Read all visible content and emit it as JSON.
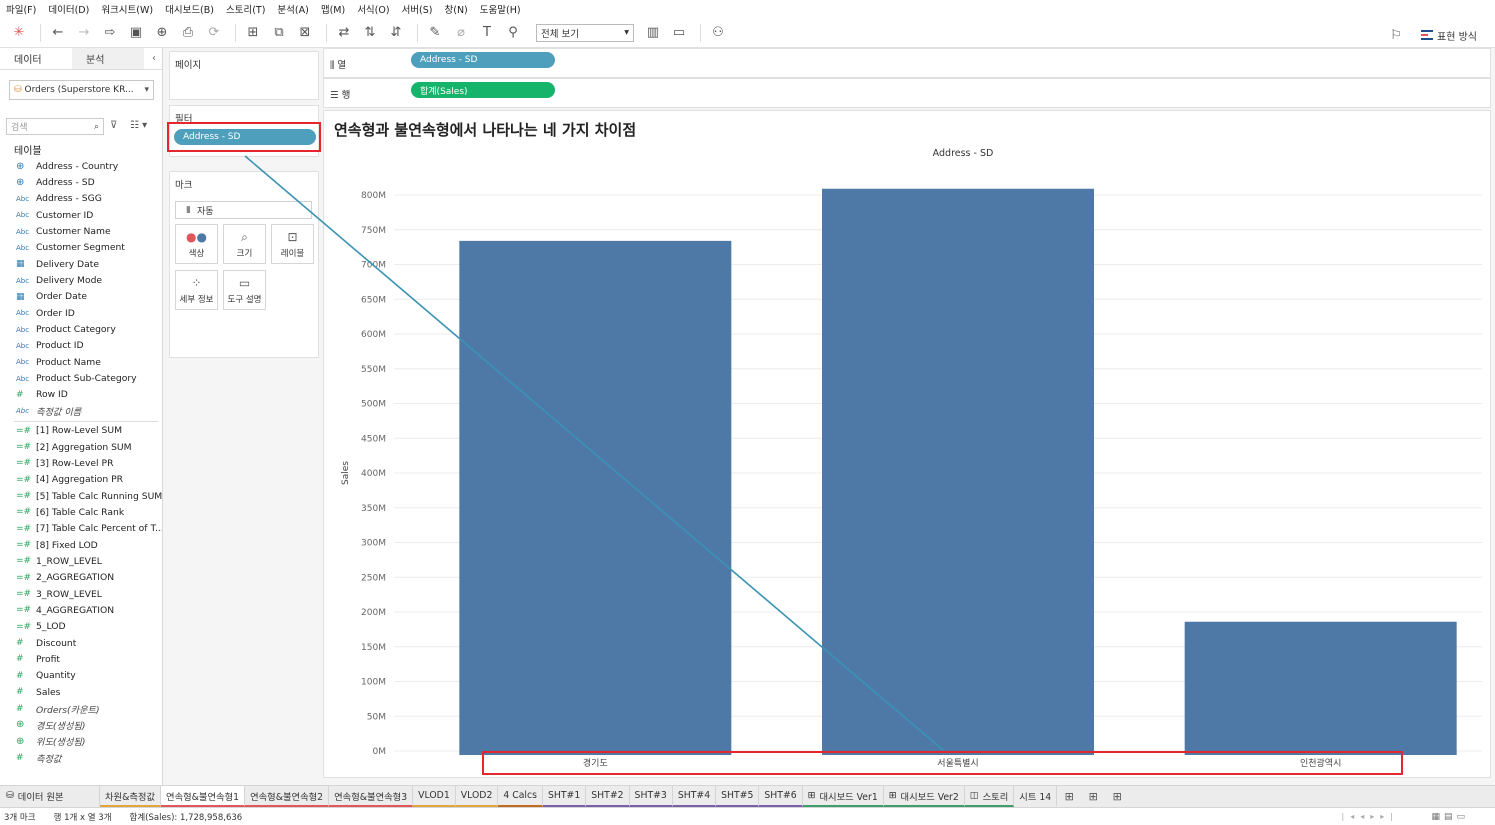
{
  "menu": [
    "파일(F)",
    "데이터(D)",
    "워크시트(W)",
    "대시보드(B)",
    "스토리(T)",
    "분석(A)",
    "맵(M)",
    "서식(O)",
    "서버(S)",
    "창(N)",
    "도움말(H)"
  ],
  "toolbar": {
    "fit_select": "전체 보기",
    "presentation_mode": "표현 방식"
  },
  "data_pane": {
    "tab_data": "데이터",
    "tab_analysis": "분석",
    "datasource": "Orders (Superstore KR...",
    "search_placeholder": "검색",
    "tables_label": "테이블",
    "fields": [
      {
        "type": "geo",
        "name": "Address - Country"
      },
      {
        "type": "geo",
        "name": "Address - SD"
      },
      {
        "type": "abc",
        "name": "Address - SGG"
      },
      {
        "type": "abc",
        "name": "Customer ID"
      },
      {
        "type": "abc",
        "name": "Customer Name"
      },
      {
        "type": "abc",
        "name": "Customer Segment"
      },
      {
        "type": "date",
        "name": "Delivery Date"
      },
      {
        "type": "abc",
        "name": "Delivery Mode"
      },
      {
        "type": "date",
        "name": "Order Date"
      },
      {
        "type": "abc",
        "name": "Order ID"
      },
      {
        "type": "abc",
        "name": "Product Category"
      },
      {
        "type": "abc",
        "name": "Product ID"
      },
      {
        "type": "abc",
        "name": "Product Name"
      },
      {
        "type": "abc",
        "name": "Product Sub-Category"
      },
      {
        "type": "num",
        "name": "Row ID"
      },
      {
        "type": "abc",
        "name": "측정값 이름",
        "italic": true
      },
      {
        "type": "sep"
      },
      {
        "type": "calc",
        "name": "[1] Row-Level SUM"
      },
      {
        "type": "calc",
        "name": "[2] Aggregation SUM"
      },
      {
        "type": "calc",
        "name": "[3] Row-Level PR"
      },
      {
        "type": "calc",
        "name": "[4] Aggregation PR"
      },
      {
        "type": "calc",
        "name": "[5] Table Calc Running SUM"
      },
      {
        "type": "calc",
        "name": "[6] Table Calc Rank"
      },
      {
        "type": "calc",
        "name": "[7] Table Calc Percent of T..."
      },
      {
        "type": "calc",
        "name": "[8] Fixed LOD"
      },
      {
        "type": "calc",
        "name": "1_ROW_LEVEL"
      },
      {
        "type": "calc",
        "name": "2_AGGREGATION"
      },
      {
        "type": "calc",
        "name": "3_ROW_LEVEL"
      },
      {
        "type": "calc",
        "name": "4_AGGREGATION"
      },
      {
        "type": "calc",
        "name": "5_LOD"
      },
      {
        "type": "num",
        "name": "Discount"
      },
      {
        "type": "num",
        "name": "Profit"
      },
      {
        "type": "num",
        "name": "Quantity"
      },
      {
        "type": "num",
        "name": "Sales"
      },
      {
        "type": "num",
        "name": "Orders(카운트)",
        "italic": true
      },
      {
        "type": "geo-green",
        "name": "경도(생성됨)",
        "italic": true
      },
      {
        "type": "geo-green",
        "name": "위도(생성됨)",
        "italic": true
      },
      {
        "type": "num",
        "name": "측정값",
        "italic": true
      }
    ]
  },
  "shelves": {
    "pages_title": "페이지",
    "filters_title": "필터",
    "filter_pill": "Address - SD",
    "marks_title": "마크",
    "marks_type": "자동",
    "mark_buttons": [
      "색상",
      "크기",
      "레이블",
      "세부 정보",
      "도구 설명"
    ],
    "columns_label": "열",
    "columns_pill": "Address - SD",
    "rows_label": "행",
    "rows_pill": "합계(Sales)"
  },
  "sheet": {
    "title": "연속형과 불연속형에서 나타나는 네 가지 차이점"
  },
  "chart_data": {
    "type": "bar",
    "title": "연속형과 불연속형에서 나타나는 네 가지 차이점",
    "column_header": "Address - SD",
    "ylabel": "Sales",
    "categories": [
      "경기도",
      "서울특별시",
      "인천광역시"
    ],
    "values": [
      734000000,
      809000000,
      186000000
    ],
    "ylim": [
      0,
      800000000
    ],
    "yticks": [
      0,
      50000000,
      100000000,
      150000000,
      200000000,
      250000000,
      300000000,
      350000000,
      400000000,
      450000000,
      500000000,
      550000000,
      600000000,
      650000000,
      700000000,
      750000000,
      800000000
    ],
    "ytick_labels": [
      "0M",
      "50M",
      "100M",
      "150M",
      "200M",
      "250M",
      "300M",
      "350M",
      "400M",
      "450M",
      "500M",
      "550M",
      "600M",
      "650M",
      "700M",
      "750M",
      "800M"
    ],
    "bar_color": "#4e79a7",
    "grid": true
  },
  "colors": {
    "dimension_pill": "#4e9fbb",
    "measure_pill": "#16b36b",
    "highlight_box": "#e5262c",
    "annotation_line": "#3a93b3"
  },
  "tabs": [
    {
      "label": "데이터 원본",
      "icon": "datasource-icon",
      "accent": ""
    },
    {
      "label": "차원&측정값",
      "accent": "#e0a63b"
    },
    {
      "label": "연속형&불연속형1",
      "accent": "#e15759",
      "active": true
    },
    {
      "label": "연속형&불연속형2",
      "accent": "#e15759"
    },
    {
      "label": "연속형&불연속형3",
      "accent": "#e15759"
    },
    {
      "label": "VLOD1",
      "accent": "#e0a63b"
    },
    {
      "label": "VLOD2",
      "accent": "#e0a63b"
    },
    {
      "label": "4 Calcs",
      "accent": "#c16a1e"
    },
    {
      "label": "SHT#1",
      "accent": "#7b5fa8"
    },
    {
      "label": "SHT#2",
      "accent": "#7b5fa8"
    },
    {
      "label": "SHT#3",
      "accent": "#7b5fa8"
    },
    {
      "label": "SHT#4",
      "accent": "#7b5fa8"
    },
    {
      "label": "SHT#5",
      "accent": "#7b5fa8"
    },
    {
      "label": "SHT#6",
      "accent": "#7b5fa8"
    },
    {
      "label": "대시보드 Ver1",
      "icon": "dashboard-icon",
      "accent": "#3f9d6a"
    },
    {
      "label": "대시보드 Ver2",
      "icon": "dashboard-icon",
      "accent": "#3f9d6a"
    },
    {
      "label": "스토리",
      "icon": "story-icon",
      "accent": "#3f9d6a"
    },
    {
      "label": "시트 14",
      "accent": ""
    }
  ],
  "status": {
    "marks": "3개 마크",
    "rows_cols": "행 1개 x 열 3개",
    "sum": "합계(Sales): 1,728,958,636"
  }
}
